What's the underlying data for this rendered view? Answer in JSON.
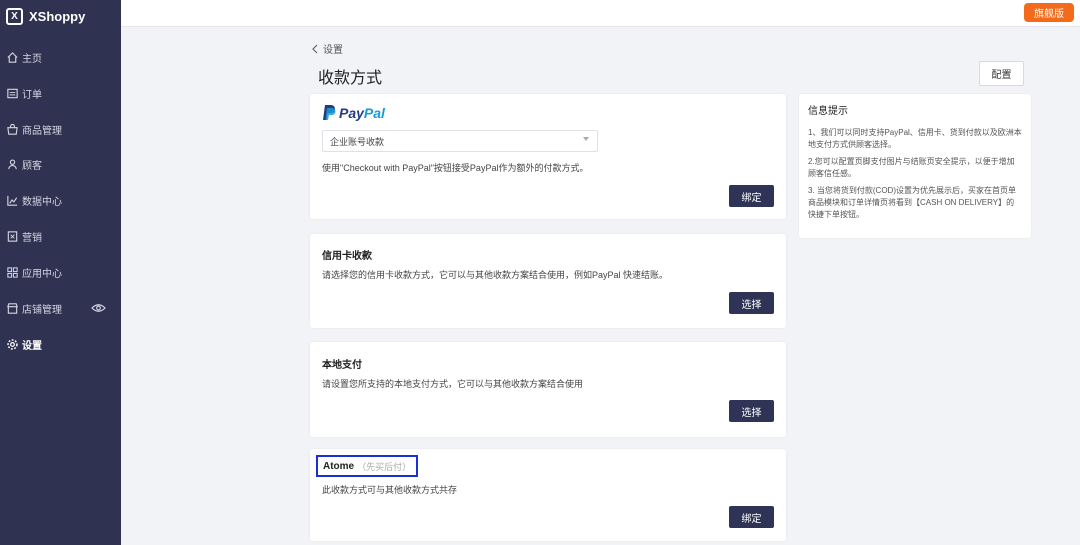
{
  "app": {
    "name": "XShoppy",
    "logo_mark": "X",
    "plan_badge": "旗舰版"
  },
  "sidebar": {
    "items": [
      {
        "label": "主页",
        "icon": "home-icon"
      },
      {
        "label": "订单",
        "icon": "orders-icon"
      },
      {
        "label": "商品管理",
        "icon": "products-icon"
      },
      {
        "label": "顾客",
        "icon": "customers-icon"
      },
      {
        "label": "数据中心",
        "icon": "analytics-icon"
      },
      {
        "label": "营销",
        "icon": "marketing-icon"
      },
      {
        "label": "应用中心",
        "icon": "apps-icon"
      },
      {
        "label": "店铺管理",
        "icon": "store-icon"
      },
      {
        "label": "设置",
        "icon": "settings-icon",
        "active": true
      }
    ]
  },
  "header": {
    "breadcrumb": "设置",
    "title": "收款方式",
    "config_label": "配置"
  },
  "cards": {
    "paypal": {
      "logo_pay": "Pay",
      "logo_pal": "Pal",
      "select_value": "企业账号收款",
      "desc": "使用\"Checkout with PayPal\"按钮接受PayPal作为额外的付款方式。",
      "button": "绑定"
    },
    "credit": {
      "title": "信用卡收款",
      "desc": "请选择您的信用卡收款方式，它可以与其他收款方案结合使用，例如PayPal 快速结账。",
      "button": "选择"
    },
    "local": {
      "title": "本地支付",
      "desc": "请设置您所支持的本地支付方式，它可以与其他收款方案结合使用",
      "button": "选择"
    },
    "atome": {
      "title": "Atome",
      "subtitle": "（先买后付）",
      "desc": "此收款方式可与其他收款方式共存",
      "button": "绑定"
    }
  },
  "info": {
    "title": "信息提示",
    "items": [
      "1、我们可以同时支持PayPal、信用卡、货到付款以及欧洲本地支付方式供顾客选择。",
      "2.您可以配置页脚支付图片与结账页安全提示，以便于增加顾客信任感。",
      "3. 当您将货到付款(COD)设置为优先展示后，买家在首页单商品模块和订单详情页将看到【CASH ON DELIVERY】的快捷下单按钮。"
    ]
  },
  "colors": {
    "sidebar_bg": "#2f3250",
    "button_bg": "#2f3456",
    "badge_bg": "#f46a1b",
    "highlight": "#1c2fd6"
  }
}
